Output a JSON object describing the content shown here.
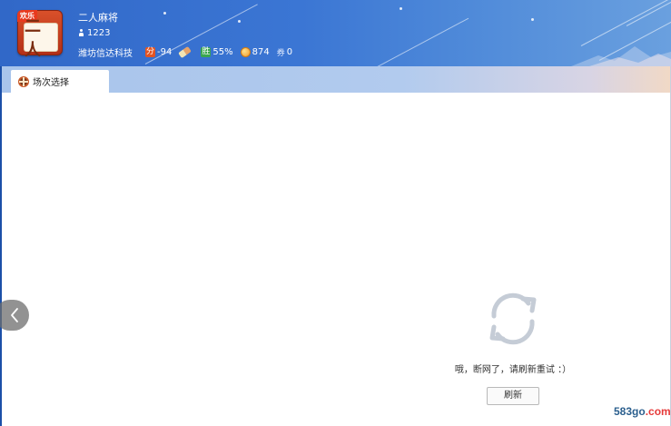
{
  "header": {
    "logo_badge": "欢乐",
    "logo_tile_text": "二人",
    "game_title": "二人麻将",
    "players": "1223",
    "company": "潍坊信达科技",
    "score_badge": "分",
    "score_value": "-94",
    "win_badge": "胜",
    "win_rate": "55%",
    "coins": "874",
    "ticket_badge": "券",
    "tickets": "0"
  },
  "tabs": [
    {
      "label": "场次选择",
      "icon": "wheel-icon",
      "active": true
    }
  ],
  "error": {
    "icon": "refresh-cycle-icon",
    "message": "哦，断网了，请刷新重试 ：）",
    "button_label": "刷新"
  },
  "watermark": {
    "main": "583go",
    "suffix": ".com"
  },
  "colors": {
    "header_blue": "#3168c8",
    "tab_strip": "#a8c4eb",
    "refresh_icon": "#c5ccd6",
    "watermark_blue": "#2b5f8e",
    "watermark_red": "#e63a3a"
  }
}
